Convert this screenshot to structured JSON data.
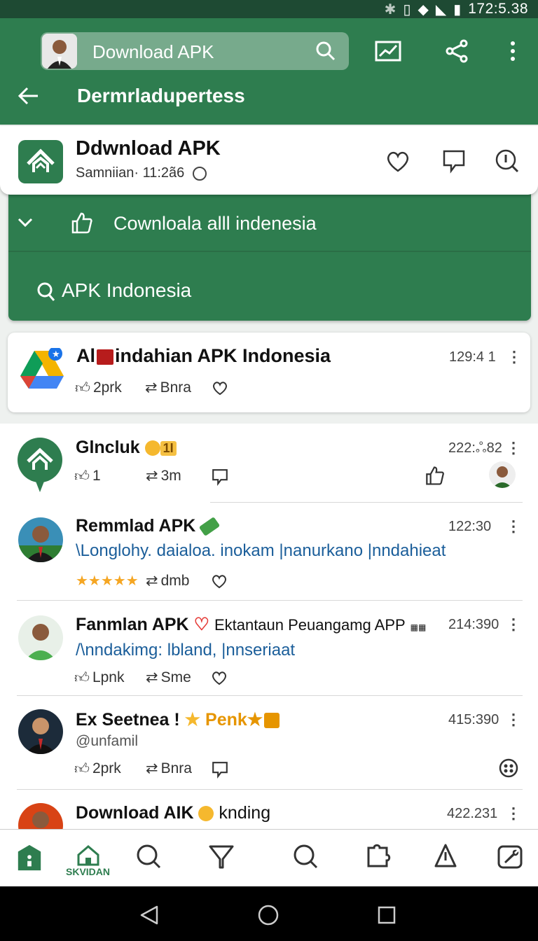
{
  "status_bar": {
    "time": "172:5.38"
  },
  "app_bar": {
    "search_label": "Download APK",
    "back_title": "Dermrladupertess"
  },
  "header": {
    "name": "Ddwnload APK",
    "meta": "Samniian· 11:2ã6"
  },
  "dropdown": {
    "row1_label": "Cownloala alll indenesia",
    "row2_label": "APK  Indonesia"
  },
  "featured": {
    "title": "Al",
    "title_rest": "indahian APK Indonesia",
    "time": "129:4 1",
    "like": "2prk",
    "repost": "Bnra"
  },
  "posts": [
    {
      "title": "Glncluk",
      "tag": "1I",
      "time": "222:ஃ82",
      "like": "1",
      "repost": "3m"
    },
    {
      "title": "Remmlad APK",
      "time": "122:30",
      "sub": "\\Longlohy. daialoa. inokam |nanurkano |nndahieat",
      "stars": "★★★★★",
      "repost": "dmb"
    },
    {
      "title": "Fanmlan APK",
      "extra": "Ektantaun Peuangamg APP",
      "time": "214:390",
      "sub": "/\\nndakimg: lbland, |nnseriaat",
      "like": "Lpnk",
      "repost": "Sme"
    },
    {
      "title": "Ex Seetnea !",
      "highlight": "Penk",
      "time": "415:390",
      "handle": "@unfamil",
      "like": "2prk",
      "repost": "Bnra"
    },
    {
      "title": "Download AIK",
      "extra": "knding",
      "time": "422.231"
    }
  ],
  "bottom_nav": {
    "home_label": "SKVIDAN"
  },
  "colors": {
    "primary": "#2e7d4f",
    "dark": "#1e4a33",
    "link": "#1b5e9a"
  }
}
